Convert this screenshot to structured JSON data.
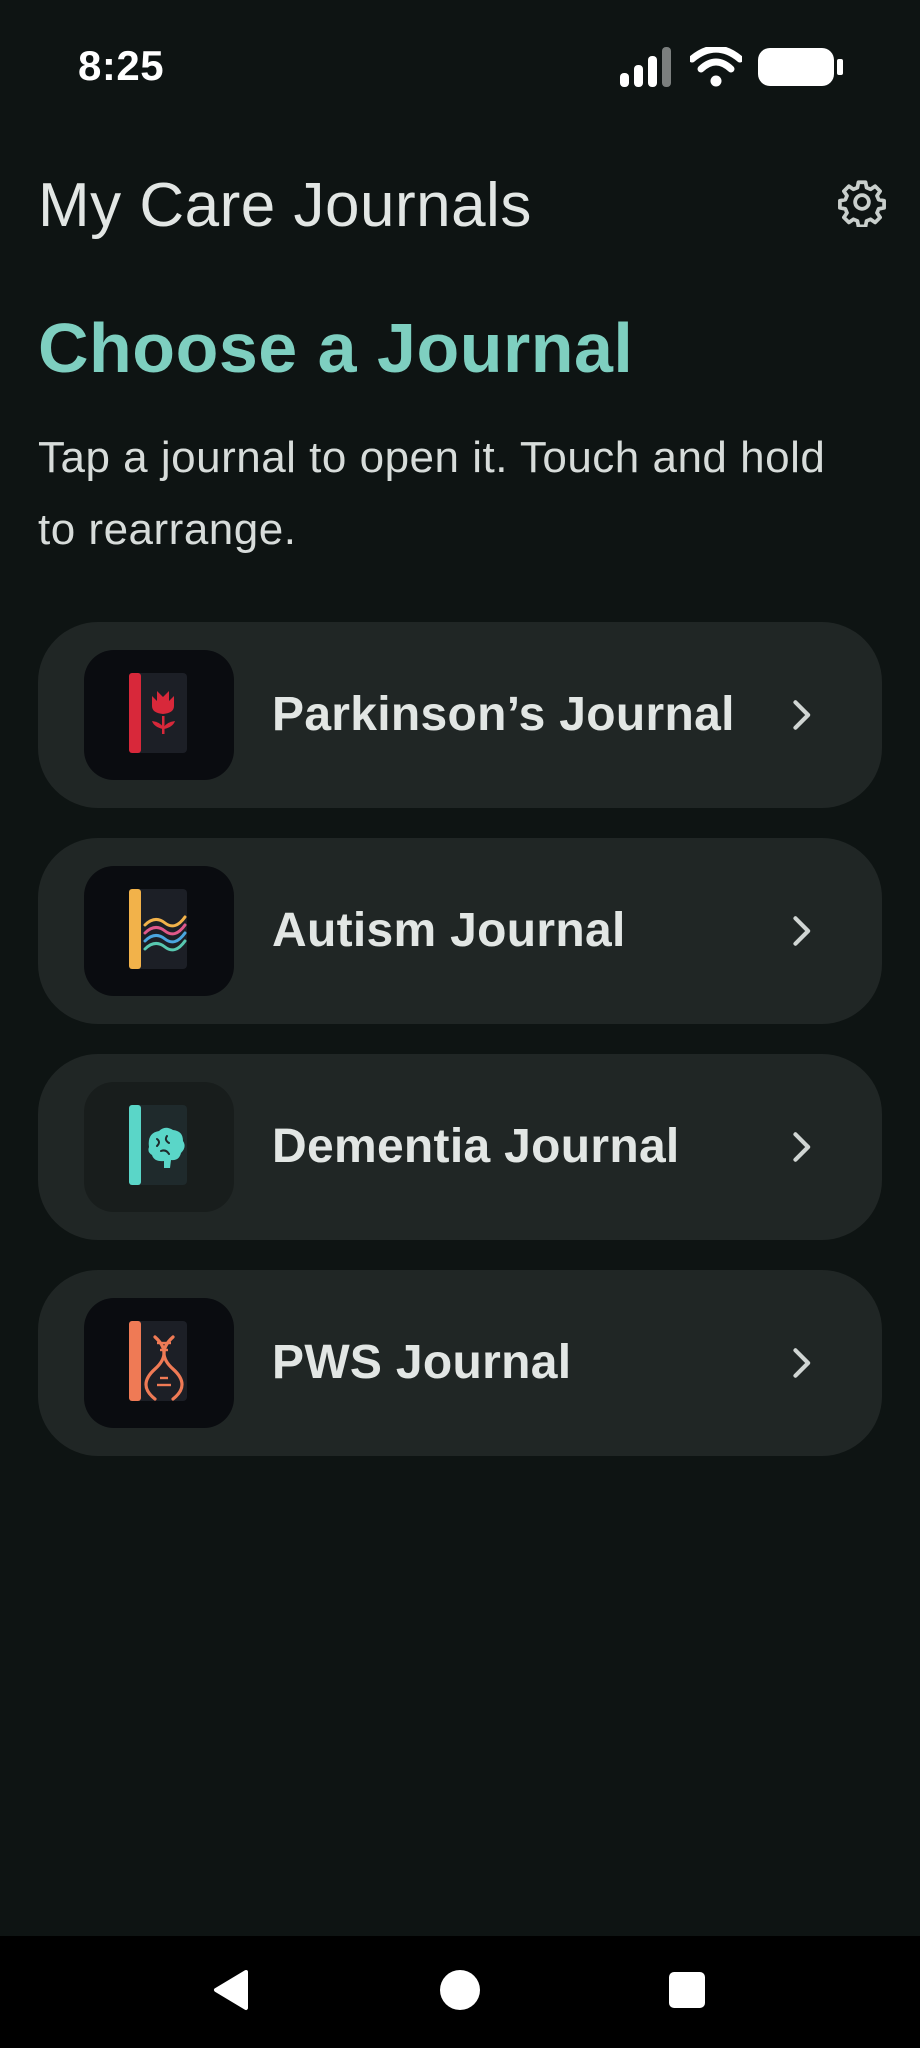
{
  "status_bar": {
    "time": "8:25"
  },
  "header": {
    "title": "My Care Journals",
    "settings_icon": "gear-icon"
  },
  "intro": {
    "heading": "Choose a Journal",
    "description": "Tap a journal to open it. Touch and hold to rearrange."
  },
  "journals": [
    {
      "label": "Parkinson’s Journal",
      "icon": "tulip-book-icon",
      "accent": "#d8283a"
    },
    {
      "label": "Autism Journal",
      "icon": "waves-book-icon",
      "accent": "#f2b24a"
    },
    {
      "label": "Dementia Journal",
      "icon": "brain-book-icon",
      "accent": "#5ad6c8"
    },
    {
      "label": "PWS Journal",
      "icon": "dna-book-icon",
      "accent": "#ef7a55"
    }
  ],
  "nav": {
    "back_icon": "back-triangle-icon",
    "home_icon": "home-circle-icon",
    "recents_icon": "recents-square-icon"
  },
  "colors": {
    "background": "#0e1413",
    "card": "#202625",
    "heading_accent": "#7ecfc0"
  }
}
